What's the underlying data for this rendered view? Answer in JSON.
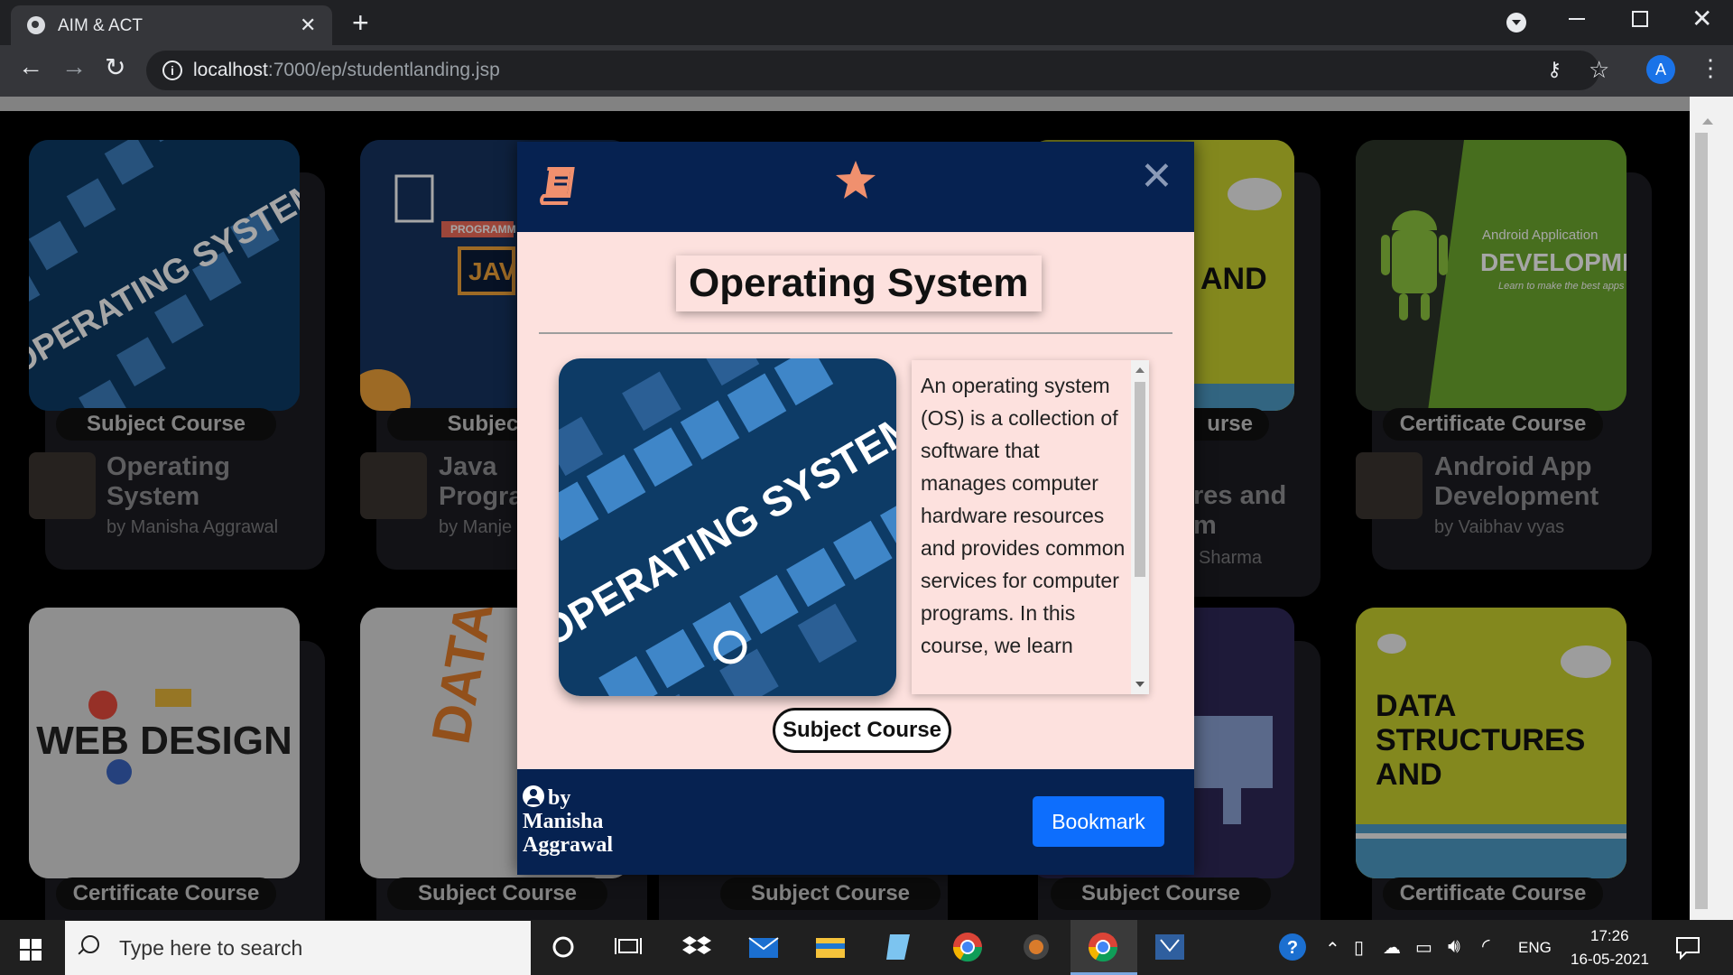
{
  "browser": {
    "tab_title": "AIM & ACT",
    "tab_close": "✕",
    "new_tab": "+",
    "url_host": "localhost",
    "url_path": ":7000/ep/studentlanding.jsp",
    "profile_initial": "A"
  },
  "cards": [
    {
      "badge": "Subject Course",
      "title": "Operating System",
      "author": "by Manisha Aggrawal"
    },
    {
      "badge": "Subject C",
      "title": "Java Progra",
      "author": "by Manje"
    },
    {
      "badge": "urse",
      "title": "res and\nm",
      "author": "Sharma"
    },
    {
      "badge": "Certificate Course",
      "title": "Android App Development",
      "author": "by Vaibhav vyas"
    },
    {
      "badge": "Certificate Course"
    },
    {
      "badge": "Subject Course"
    },
    {
      "badge": "Subject Course"
    },
    {
      "badge": "Subject Course"
    },
    {
      "badge": "Certificate Course"
    }
  ],
  "card_images": {
    "os": "OPERATING SYSTEM",
    "java": "JAV",
    "java_tag": "PROGRAMM",
    "android_title": "Android Application",
    "android_big": "DEVELOPMENT",
    "android_sub": "Learn to make the best apps",
    "web": "WEB DESIGN",
    "db": "DATAB",
    "ds_partial": "AND",
    "dsa": "DATA STRUCTURES AND ALGORITHMS"
  },
  "modal": {
    "title": "Operating System",
    "image_text": "OPERATING SYSTEM",
    "description": "An operating system (OS) is a collection of software that manages computer hardware resources and provides common services for computer programs. In this course, we learn",
    "badge": "Subject Course",
    "by_label": "by",
    "author_first": "Manisha",
    "author_last": "Aggrawal",
    "bookmark_label": "Bookmark",
    "close_symbol": "✕",
    "accent_color": "#f0906e",
    "header_color": "#062251",
    "body_color": "#fde1de"
  },
  "taskbar": {
    "search_placeholder": "Type here to search",
    "language": "ENG",
    "time": "17:26",
    "date": "16-05-2021",
    "icons": [
      "cortana-icon",
      "task-view-icon",
      "dropbox-icon",
      "mail-icon",
      "file-explorer-icon",
      "notepad-icon",
      "chrome-icon",
      "settings-app-icon",
      "chrome-active-icon",
      "remote-desktop-icon"
    ]
  }
}
